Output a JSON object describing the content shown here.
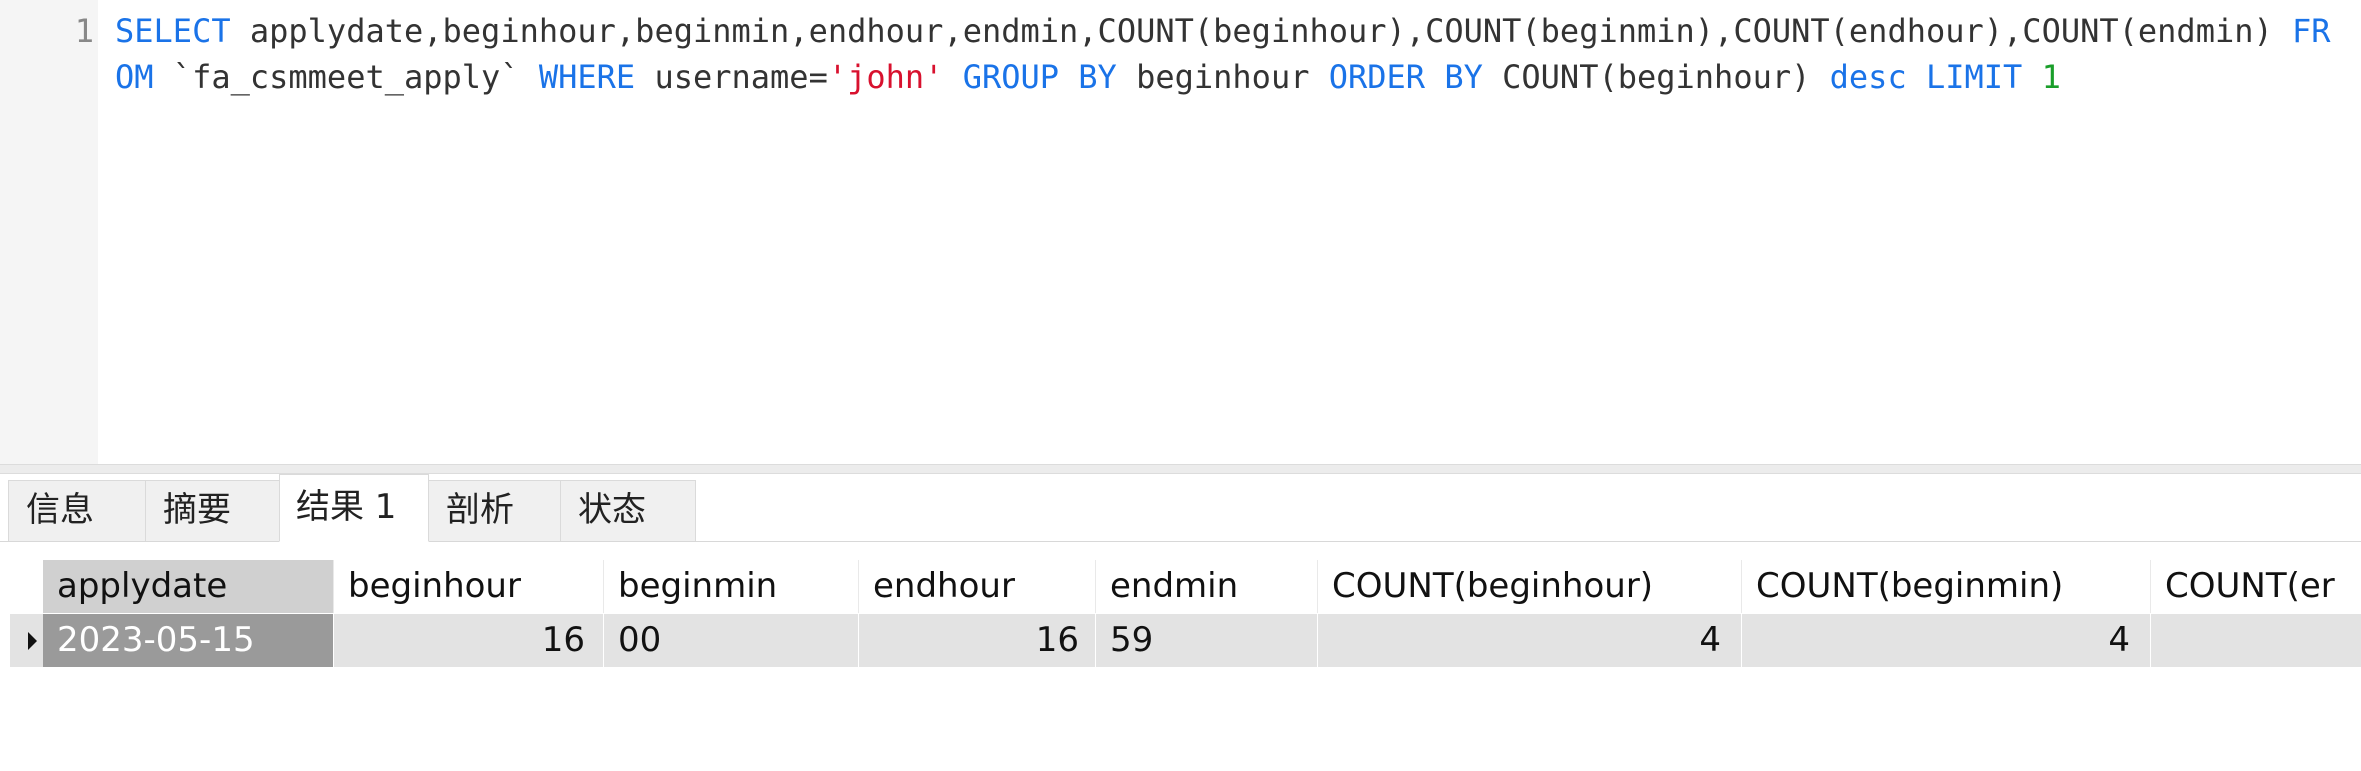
{
  "editor": {
    "line_number": "1",
    "sql_tokens": [
      {
        "t": "SELECT",
        "k": "kw"
      },
      {
        "t": " applydate,beginhour,beginmin,endhour,endmin,COUNT(beginhour),COUNT(beginmin),COUNT(endhour),",
        "k": "plain"
      },
      {
        "t": "COUNT(endmin) ",
        "k": "plain"
      },
      {
        "t": "FROM",
        "k": "kw"
      },
      {
        "t": " `fa_csmmeet_apply` ",
        "k": "plain"
      },
      {
        "t": "WHERE",
        "k": "kw"
      },
      {
        "t": " username=",
        "k": "plain"
      },
      {
        "t": "'john'",
        "k": "str"
      },
      {
        "t": " ",
        "k": "plain"
      },
      {
        "t": "GROUP BY",
        "k": "kw"
      },
      {
        "t": " beginhour ",
        "k": "plain"
      },
      {
        "t": "ORDER BY",
        "k": "kw"
      },
      {
        "t": " COUNT(",
        "k": "plain"
      },
      {
        "t": "beginhour) ",
        "k": "plain"
      },
      {
        "t": "desc",
        "k": "kw"
      },
      {
        "t": " ",
        "k": "plain"
      },
      {
        "t": "LIMIT",
        "k": "kw"
      },
      {
        "t": " ",
        "k": "plain"
      },
      {
        "t": "1",
        "k": "num"
      }
    ],
    "colors": {
      "keyword": "#1a73e8",
      "string": "#d8112e",
      "number": "#1a9e2a",
      "text": "#333333"
    }
  },
  "tabs": [
    {
      "label": "信息",
      "active": false
    },
    {
      "label": "摘要",
      "active": false
    },
    {
      "label": "结果 1",
      "active": true
    },
    {
      "label": "剖析",
      "active": false
    },
    {
      "label": "状态",
      "active": false
    }
  ],
  "grid": {
    "columns": [
      "applydate",
      "beginhour",
      "beginmin",
      "endhour",
      "endmin",
      "COUNT(beginhour)",
      "COUNT(beginmin)",
      "COUNT(er"
    ],
    "rows": [
      [
        "2023-05-15",
        "16",
        "00",
        "16",
        "59",
        "4",
        "4",
        ""
      ]
    ]
  }
}
